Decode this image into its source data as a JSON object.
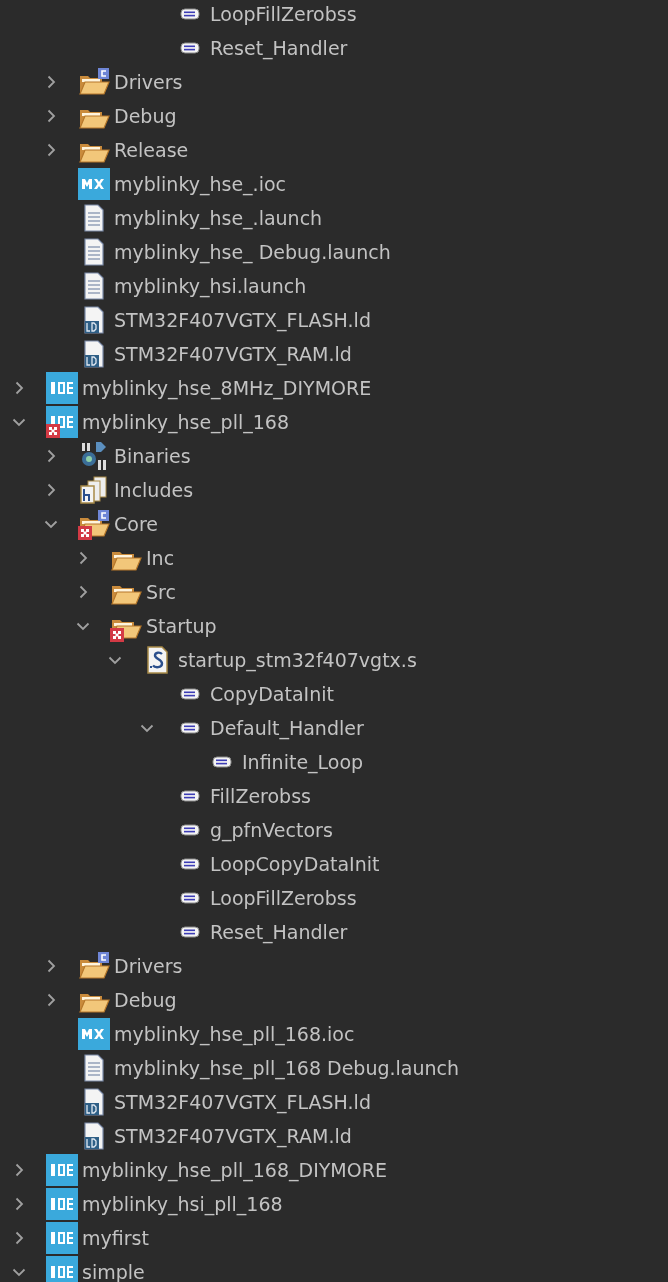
{
  "tree": [
    {
      "children": [
        {
          "children": [
            {
              "children": [
                {
                  "children": [
                    {
                      "label": "LoopFillZerobss",
                      "kind": "symbol"
                    },
                    {
                      "label": "Reset_Handler",
                      "kind": "symbol"
                    }
                  ]
                }
              ]
            }
          ]
        },
        {
          "label": "Drivers",
          "kind": "source-folder",
          "expanded": false
        },
        {
          "label": "Debug",
          "kind": "folder",
          "expanded": false
        },
        {
          "label": "Release",
          "kind": "folder",
          "expanded": false
        },
        {
          "label": "myblinky_hse_.ioc",
          "kind": "ioc"
        },
        {
          "label": "myblinky_hse_.launch",
          "kind": "launch"
        },
        {
          "label": "myblinky_hse_ Debug.launch",
          "kind": "launch"
        },
        {
          "label": "myblinky_hsi.launch",
          "kind": "launch"
        },
        {
          "label": "STM32F407VGTX_FLASH.ld",
          "kind": "ld"
        },
        {
          "label": "STM32F407VGTX_RAM.ld",
          "kind": "ld"
        }
      ]
    },
    {
      "label": "myblinky_hse_8MHz_DIYMORE",
      "kind": "project",
      "expanded": false,
      "error": false
    },
    {
      "label": "myblinky_hse_pll_168",
      "kind": "project",
      "expanded": true,
      "error": true,
      "children": [
        {
          "label": "Binaries",
          "kind": "binaries",
          "expanded": false
        },
        {
          "label": "Includes",
          "kind": "includes",
          "expanded": false
        },
        {
          "label": "Core",
          "kind": "source-folder",
          "expanded": true,
          "error": true,
          "children": [
            {
              "label": "Inc",
              "kind": "folder",
              "expanded": false
            },
            {
              "label": "Src",
              "kind": "folder",
              "expanded": false
            },
            {
              "label": "Startup",
              "kind": "folder",
              "expanded": true,
              "error": true,
              "children": [
                {
                  "label": "startup_stm32f407vgtx.s",
                  "kind": "asm",
                  "expanded": true,
                  "children": [
                    {
                      "label": "CopyDataInit",
                      "kind": "symbol"
                    },
                    {
                      "label": "Default_Handler",
                      "kind": "symbol",
                      "expanded": true,
                      "children": [
                        {
                          "label": "Infinite_Loop",
                          "kind": "symbol"
                        }
                      ]
                    },
                    {
                      "label": "FillZerobss",
                      "kind": "symbol"
                    },
                    {
                      "label": "g_pfnVectors",
                      "kind": "symbol"
                    },
                    {
                      "label": "LoopCopyDataInit",
                      "kind": "symbol"
                    },
                    {
                      "label": "LoopFillZerobss",
                      "kind": "symbol"
                    },
                    {
                      "label": "Reset_Handler",
                      "kind": "symbol"
                    }
                  ]
                }
              ]
            }
          ]
        },
        {
          "label": "Drivers",
          "kind": "source-folder",
          "expanded": false
        },
        {
          "label": "Debug",
          "kind": "folder",
          "expanded": false
        },
        {
          "label": "myblinky_hse_pll_168.ioc",
          "kind": "ioc"
        },
        {
          "label": "myblinky_hse_pll_168 Debug.launch",
          "kind": "launch"
        },
        {
          "label": "STM32F407VGTX_FLASH.ld",
          "kind": "ld"
        },
        {
          "label": "STM32F407VGTX_RAM.ld",
          "kind": "ld"
        }
      ]
    },
    {
      "label": "myblinky_hse_pll_168_DIYMORE",
      "kind": "project",
      "expanded": false,
      "error": false
    },
    {
      "label": "myblinky_hsi_pll_168",
      "kind": "project",
      "expanded": false,
      "error": false
    },
    {
      "label": "myfirst",
      "kind": "project",
      "expanded": false,
      "error": false
    },
    {
      "label": "simple",
      "kind": "project",
      "expanded": true,
      "error": false
    }
  ]
}
